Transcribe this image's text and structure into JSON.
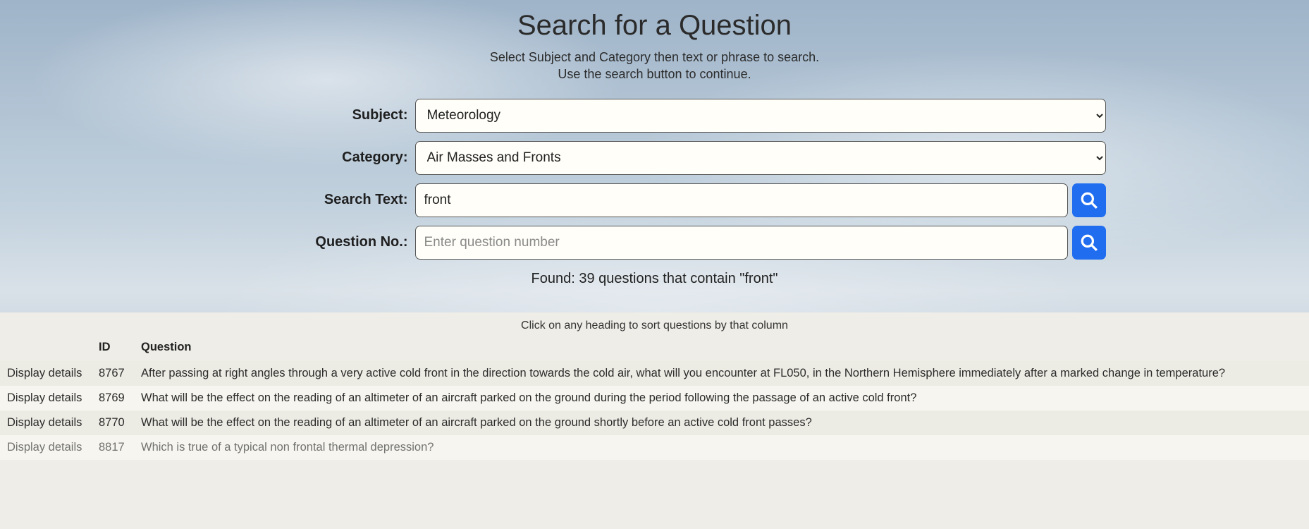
{
  "title": "Search for a Question",
  "subtitle_line1": "Select Subject and Category then text or phrase to search.",
  "subtitle_line2": "Use the search button to continue.",
  "labels": {
    "subject": "Subject:",
    "category": "Category:",
    "search_text": "Search Text:",
    "question_no": "Question No.:"
  },
  "fields": {
    "subject_value": "Meteorology",
    "category_value": "Air Masses and Fronts",
    "search_text_value": "front",
    "question_no_value": "",
    "question_no_placeholder": "Enter question number"
  },
  "found_text": "Found: 39 questions that contain \"front\"",
  "sort_hint": "Click on any heading to sort questions by that column",
  "columns": {
    "action": "",
    "id": "ID",
    "question": "Question"
  },
  "action_label": "Display details",
  "rows": [
    {
      "id": "8767",
      "q": "After passing at right angles through a very active cold front in the direction towards the cold air, what will you encounter at FL050, in the Northern Hemisphere immediately after a marked change in temperature?"
    },
    {
      "id": "8769",
      "q": "What will be the effect on the reading of an altimeter of an aircraft parked on the ground during the period following the passage of an active cold front?"
    },
    {
      "id": "8770",
      "q": "What will be the effect on the reading of an altimeter of an aircraft parked on the ground shortly before an active cold front passes?"
    },
    {
      "id": "8817",
      "q": "Which is true of a typical non frontal thermal depression?"
    }
  ]
}
